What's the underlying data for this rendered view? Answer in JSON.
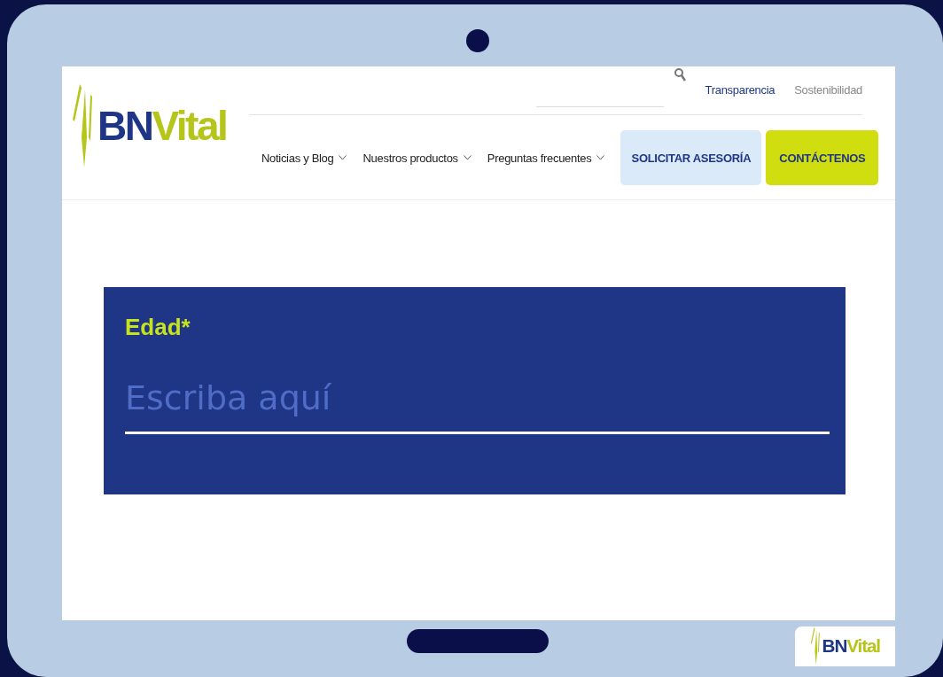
{
  "header": {
    "logo": {
      "part_1": "BN",
      "part_2": "Vital"
    },
    "top_links": [
      {
        "label": "Transparencia",
        "kind": "strong"
      },
      {
        "label": "Sostenibilidad",
        "kind": "muted"
      }
    ],
    "nav_items": [
      {
        "label": "Noticias y Blog"
      },
      {
        "label": "Nuestros productos"
      },
      {
        "label": "Preguntas frecuentes"
      }
    ],
    "buttons": [
      {
        "label": "SOLICITAR ASESORÍA",
        "kind": "secondary"
      },
      {
        "label": "CONTÁCTENOS",
        "kind": "primary"
      }
    ]
  },
  "form": {
    "label": "Edad*",
    "placeholder": "Escriba aquí"
  },
  "badge_logo": {
    "part_1": "BN",
    "part_2": "Vital"
  }
}
